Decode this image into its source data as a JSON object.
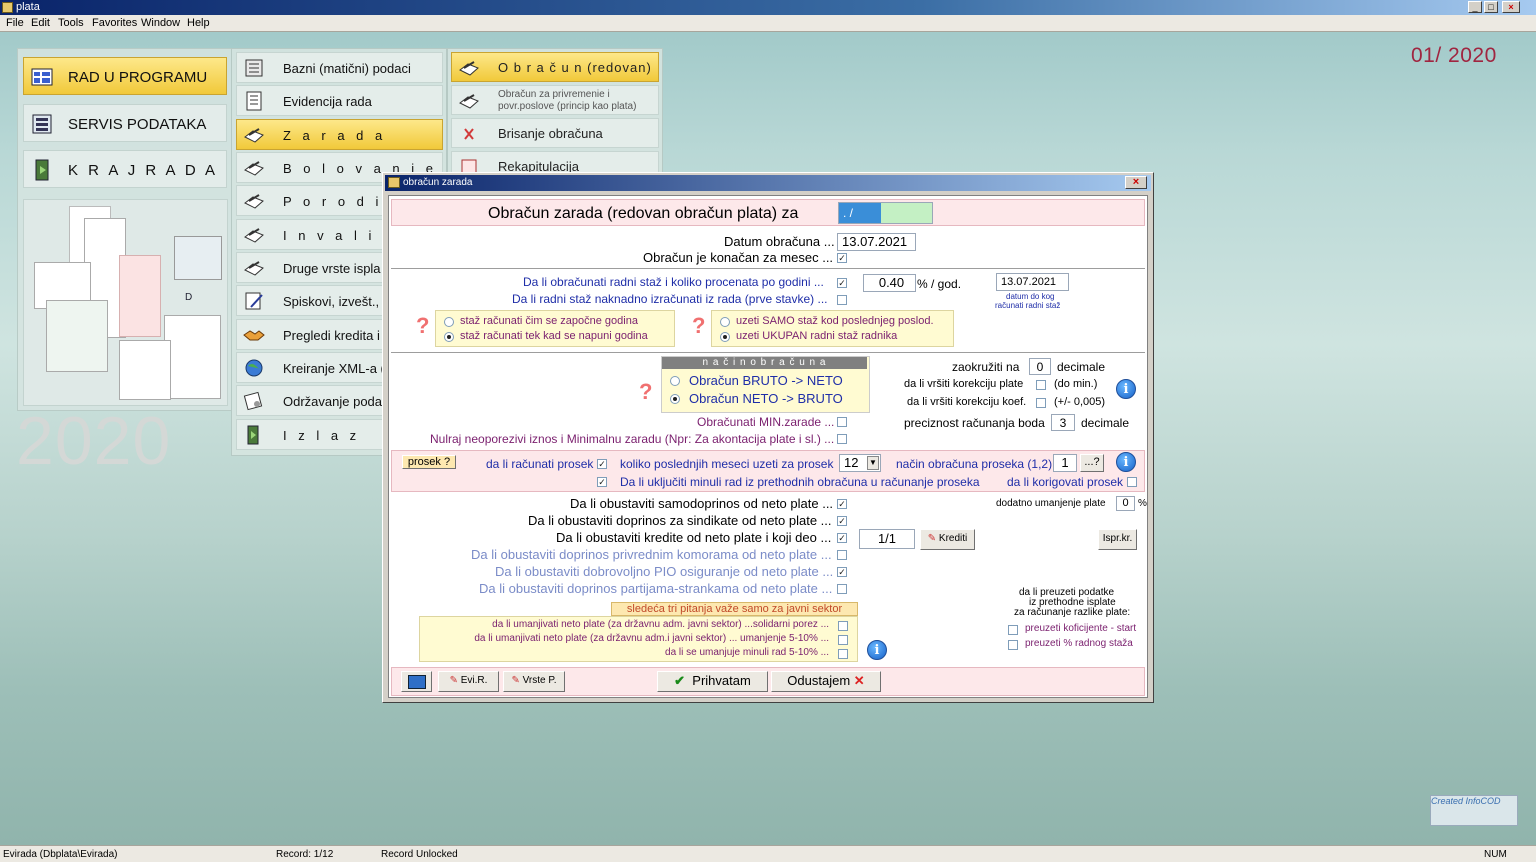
{
  "window": {
    "title": "plata"
  },
  "menu": [
    "File",
    "Edit",
    "Tools",
    "Favorites",
    "Window",
    "Help"
  ],
  "period": "01/ 2020",
  "left_menu": [
    {
      "label": "RAD  U  PROGRAMU",
      "icon": "grid-program-icon",
      "active": true
    },
    {
      "label": "SERVIS PODATAKA",
      "icon": "service-data-icon",
      "active": false
    },
    {
      "label": "K R A J   R A D A",
      "icon": "exit-door-icon",
      "active": false
    }
  ],
  "left_thumb_letter": "D",
  "year_big": "2020",
  "mid_menu": [
    {
      "label": "Bazni (matični) podaci",
      "active": false
    },
    {
      "label": "Evidencija rada",
      "active": false
    },
    {
      "label": "Z a r a d a",
      "active": true
    },
    {
      "label": "B o l o v a n j e",
      "active": false
    },
    {
      "label": "P o r o d i l j e",
      "active": false
    },
    {
      "label": "I n v a l i d i   II",
      "active": false
    },
    {
      "label": "Druge vrste ispla",
      "active": false
    },
    {
      "label": "Spiskovi, izvešt.,",
      "active": false
    },
    {
      "label": "Pregledi kredita i",
      "active": false
    },
    {
      "label": "Kreiranje XML-a  (",
      "active": false
    },
    {
      "label": "Održavanje podat",
      "active": false
    },
    {
      "label": "I z l a z",
      "active": false
    }
  ],
  "right_menu": [
    {
      "label": "O b r a č u n   (redovan)",
      "active": true
    },
    {
      "label": "Obračun za privremenie i",
      "label2": "povr.poslove (princip kao plata)",
      "active": false
    },
    {
      "label": "Brisanje obračuna",
      "active": false
    },
    {
      "label": "Rekapitulacija",
      "active": false
    }
  ],
  "dialog": {
    "title": "obračun zarada",
    "heading": "Obračun zarada (redovan obračun plata) za",
    "heading_value": " .    /",
    "datum_label": "Datum obračuna ...",
    "datum_value": "13.07.2021",
    "konacan_label": "Obračun je konačan za mesec ...",
    "staz_label": "Da li obračunati radni staž i koliko procenata po godini ...",
    "staz_value": "0.40",
    "staz_unit": "% / god.",
    "staz_date": "13.07.2021",
    "staz_date_caption1": "datum do kog",
    "staz_date_caption2": "računati radni staž",
    "naknadno_label": "Da li radni staž naknadno izračunati iz rada (prve stavke) ...",
    "staz_opt1": "staž računati čim se započne godina",
    "staz_opt2": "staž računati tek kad se napuni godina",
    "uzeti_opt1": "uzeti SAMO staž kod poslednjeg poslod.",
    "uzeti_opt2": "uzeti UKUPAN radni staž radnika",
    "nacin_header": "n a č i n    o b r a č u n a",
    "nacin_opt1": "Obračun  BRUTO -> NETO",
    "nacin_opt2": "Obračun  NETO -> BRUTO",
    "zaokruziti_label": "zaokružiti na",
    "zaokruziti_value": "0",
    "decimale": "decimale",
    "korekcija_plate_label": "da li vršiti korekciju plate",
    "korekcija_plate_hint": "(do min.)",
    "korekcija_koef_label": "da li vršiti korekciju koef.",
    "korekcija_koef_hint": "(+/- 0,005)",
    "preciznost_label": "preciznost računanja boda",
    "preciznost_value": "3",
    "min_zarade_label": "Obračunati MIN.zarade ...",
    "nulraj_label": "Nulraj   neoporezivi iznos i Minimalnu zaradu (Npr: Za akontacija plate i sl.) ...",
    "prosek_btn": "prosek ?",
    "prosek_label": "da li računati prosek",
    "poslednjih_label": "koliko poslednjih meseci uzeti za prosek",
    "poslednjih_value": "12",
    "nacin_proseka_label": "način obračuna proseka (1,2)",
    "nacin_proseka_value": "1",
    "nacin_proseka_btn": "...?",
    "minuli_label": "Da li uključiti minuli rad iz prethodnih obračuna u računanje proseka",
    "korigovati_label": "da li korigovati prosek",
    "samodoprinos_label": "Da li obustaviti samodoprinos od neto plate ...",
    "sindikat_label": "Da li obustaviti doprinos za sindikate od neto plate ...",
    "krediti_label": "Da li obustaviti kredite od neto plate i koji deo ...",
    "krediti_value": "1/1",
    "krediti_btn": "Krediti",
    "komora_label": "Da li obustaviti doprinos privrednim komorama od neto plate ...",
    "pio_label": "Da li obustaviti dobrovoljno PIO osiguranje od neto plate ...",
    "partija_label": "Da li obustaviti doprinos partijama-strankama od neto plate ...",
    "umanjenje_label": "dodatno umanjenje plate",
    "umanjenje_value": "0",
    "umanjenje_unit": "%",
    "ispr_btn": "Ispr.kr.",
    "sektor_header": "sledeća tri pitanja važe samo za javni sektor",
    "sektor1": "da li umanjivati neto plate (za državnu adm. javni sektor) ...solidarni porez ...",
    "sektor2": "da li umanjivati neto plate (za državnu adm.i javni sektor) ... umanjenje 5-10% ...",
    "sektor3": "da li se umanjuje minuli rad 5-10% ...",
    "preuzeti_caption1": "da li preuzeti podatke",
    "preuzeti_caption2": "iz prethodne isplate",
    "preuzeti_caption3": "za računanje razlike plate:",
    "preuzeti_opt1": "preuzeti koficijente - start",
    "preuzeti_opt2": "preuzeti  % radnog staža",
    "btn_evi": "Evi.R.",
    "btn_vrste": "Vrste P.",
    "btn_prihvatam": "Prihvatam",
    "btn_odustajem": "Odustajem"
  },
  "logo_text": "Created InfoCOD",
  "status": {
    "path": "Evirada (Dbplata\\Evirada)",
    "record": "Record: 1/12",
    "lock": "Record Unlocked",
    "num": "NUM"
  }
}
